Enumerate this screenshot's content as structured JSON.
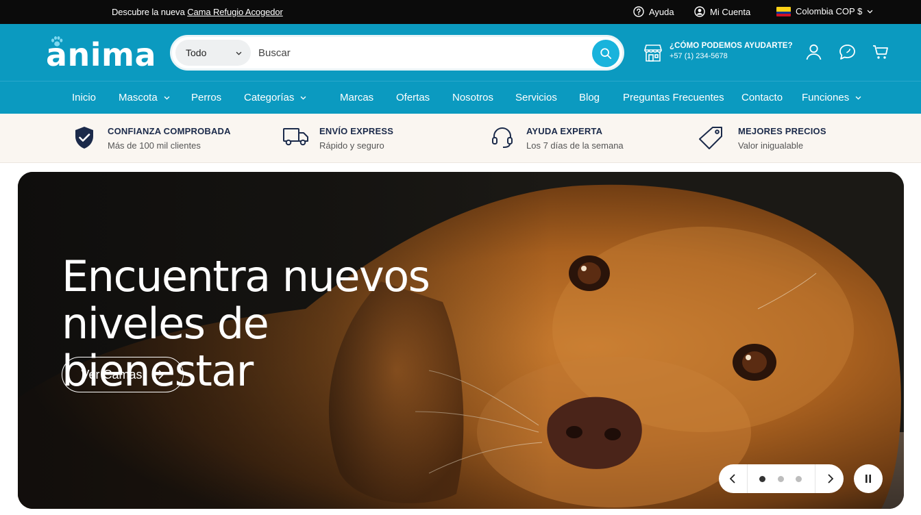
{
  "announcement": {
    "prefix": "Descubre la nueva",
    "link": "Cama Refugio Acogedor"
  },
  "topbar": {
    "help": "Ayuda",
    "account": "Mi Cuenta",
    "region": "Colombia COP $"
  },
  "header": {
    "logo": "anima",
    "search": {
      "category": "Todo",
      "placeholder": "Buscar"
    },
    "help_title": "¿CÓMO PODEMOS AYUDARTE?",
    "help_phone": "+57 (1) 234-5678"
  },
  "nav": [
    "Inicio",
    "Mascota",
    "Perros",
    "Categorías",
    "Marcas",
    "Ofertas",
    "Nosotros",
    "Servicios",
    "Blog",
    "Preguntas Frecuentes",
    "Contacto",
    "Funciones"
  ],
  "trust": [
    {
      "title": "CONFIANZA COMPROBADA",
      "subtitle": "Más de 100 mil clientes"
    },
    {
      "title": "ENVÍO EXPRESS",
      "subtitle": "Rápido y seguro"
    },
    {
      "title": "AYUDA EXPERTA",
      "subtitle": "Los 7 días de la semana"
    },
    {
      "title": "MEJORES PRECIOS",
      "subtitle": "Valor inigualable"
    }
  ],
  "hero": {
    "line1": "Encuentra nuevos",
    "line2": "niveles de bienestar",
    "cta": "Ver Camas",
    "slides_total": 3,
    "active_slide": 1
  },
  "colors": {
    "brand": "#0b9ac0",
    "topbar": "#0b0b0b",
    "search_button": "#19b3dc",
    "trust_bg": "#faf6f1"
  }
}
